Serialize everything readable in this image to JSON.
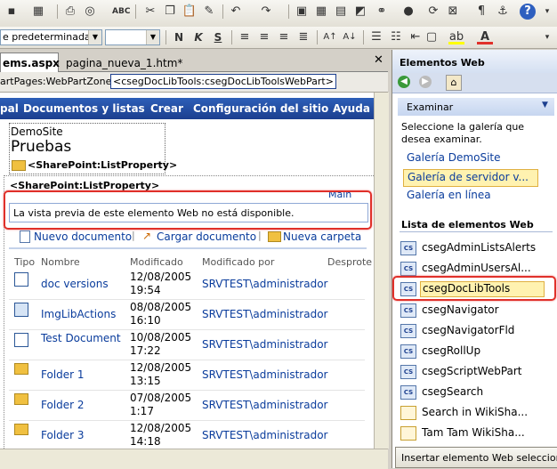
{
  "toolbar": {
    "font_value": "e predeterminada",
    "size_value": "",
    "bold": "N",
    "italic": "K",
    "underline": "S"
  },
  "tabs": {
    "active": "ems.aspx",
    "inactive": "pagina_nueva_1.htm*"
  },
  "breadcrumb": {
    "zone": "artPages:WebPartZone>",
    "current": "<csegDocLibTools:csegDocLibToolsWebPart>"
  },
  "site_nav": {
    "items": [
      "pal",
      "Documentos y listas",
      "Crear",
      "Configuración del sitio",
      "Ayuda"
    ]
  },
  "site": {
    "name": "DemoSite",
    "title": "Pruebas",
    "list_property_1": "<SharePoint:ListProperty>",
    "list_property_2": "<SharePoint:ListProperty>",
    "main_tag": "Main",
    "preview_message": "La vista previa de este elemento Web no está disponible."
  },
  "doc_toolbar": {
    "new_doc": "Nuevo documento",
    "upload": "Cargar documento",
    "new_folder": "Nueva carpeta"
  },
  "doc_table": {
    "headers": [
      "Tipo",
      "Nombre",
      "Modificado",
      "Modificado por",
      "Desprote"
    ],
    "rows": [
      {
        "name": "doc versions",
        "date": "12/08/2005",
        "time": "19:54",
        "by": "SRVTEST\\administrador",
        "icon": "word-doc-icon"
      },
      {
        "name": "ImgLibActions",
        "date": "08/08/2005",
        "time": "16:10",
        "by": "SRVTEST\\administrador",
        "icon": "image-doc-icon"
      },
      {
        "name": "Test Document",
        "date": "10/08/2005",
        "time": "17:22",
        "by": "SRVTEST\\administrador",
        "icon": "word-doc-icon"
      },
      {
        "name": "Folder 1",
        "date": "12/08/2005",
        "time": "13:15",
        "by": "SRVTEST\\administrador",
        "icon": "folder-icon"
      },
      {
        "name": "Folder 2",
        "date": "07/08/2005",
        "time": "1:17",
        "by": "SRVTEST\\administrador",
        "icon": "folder-icon"
      },
      {
        "name": "Folder 3",
        "date": "12/08/2005",
        "time": "14:18",
        "by": "SRVTEST\\administrador",
        "icon": "folder-icon"
      }
    ]
  },
  "panel": {
    "title": "Elementos Web",
    "browse_label": "Examinar",
    "instructions": "Seleccione la galería que desea examinar.",
    "galleries": [
      "Galería DemoSite",
      "Galería de servidor v...",
      "Galería en línea"
    ],
    "list_header": "Lista de elementos Web",
    "items": [
      {
        "name": "csegAdminListsAlerts",
        "icon": "cs"
      },
      {
        "name": "csegAdminUsersAl...",
        "icon": "cs"
      },
      {
        "name": "csegDocLibTools",
        "icon": "cs"
      },
      {
        "name": "csegNavigator",
        "icon": "cs"
      },
      {
        "name": "csegNavigatorFld",
        "icon": "cs"
      },
      {
        "name": "csegRollUp",
        "icon": "cs"
      },
      {
        "name": "csegScriptWebPart",
        "icon": "cs"
      },
      {
        "name": "csegSearch",
        "icon": "cs"
      },
      {
        "name": "Search in WikiSha...",
        "icon": "web"
      },
      {
        "name": "Tam Tam WikiSha...",
        "icon": "web"
      }
    ],
    "insert_label": "Insertar elemento Web seleccionado"
  },
  "colors": {
    "nav_blue": "#1c3f8f",
    "highlight_red": "#e0302a",
    "selected_yellow": "#fff2b0"
  }
}
